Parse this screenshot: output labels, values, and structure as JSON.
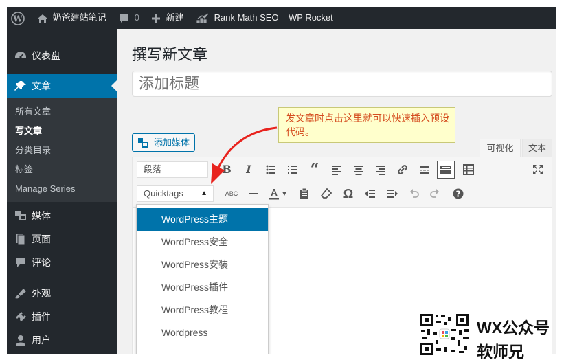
{
  "adminbar": {
    "site_name": "奶爸建站笔记",
    "comments_count": "0",
    "new_label": "新建",
    "rank_math": "Rank Math SEO",
    "wp_rocket": "WP Rocket"
  },
  "sidebar": {
    "items": [
      {
        "label": "仪表盘",
        "icon": "dashboard-icon"
      },
      {
        "label": "文章",
        "icon": "pin-icon"
      },
      {
        "label": "媒体",
        "icon": "media-icon"
      },
      {
        "label": "页面",
        "icon": "page-icon"
      },
      {
        "label": "评论",
        "icon": "comment-icon"
      },
      {
        "label": "外观",
        "icon": "appearance-icon"
      },
      {
        "label": "插件",
        "icon": "plugin-icon"
      },
      {
        "label": "用户",
        "icon": "user-icon"
      }
    ],
    "submenu": [
      "所有文章",
      "写文章",
      "分类目录",
      "标签",
      "Manage Series"
    ]
  },
  "main": {
    "page_title": "撰写新文章",
    "title_placeholder": "添加标题",
    "add_media_label": "添加媒体",
    "tab_visual": "可视化",
    "tab_text": "文本",
    "format_select": "段落",
    "quicktags_select": "Quicktags",
    "tooltip_text": "发文章时点击这里就可以快速插入预设代码。",
    "dropdown_items": [
      "WordPress主题",
      "WordPress安全",
      "WordPress安装",
      "WordPress插件",
      "WordPress教程",
      "Wordpress"
    ]
  },
  "watermark": {
    "line1": "WX公众号",
    "line2": "软师兄"
  },
  "colors": {
    "admin_dark": "#23282d",
    "accent_blue": "#0073aa",
    "tooltip_text": "#d54e21",
    "arrow_red": "#e8231e"
  }
}
